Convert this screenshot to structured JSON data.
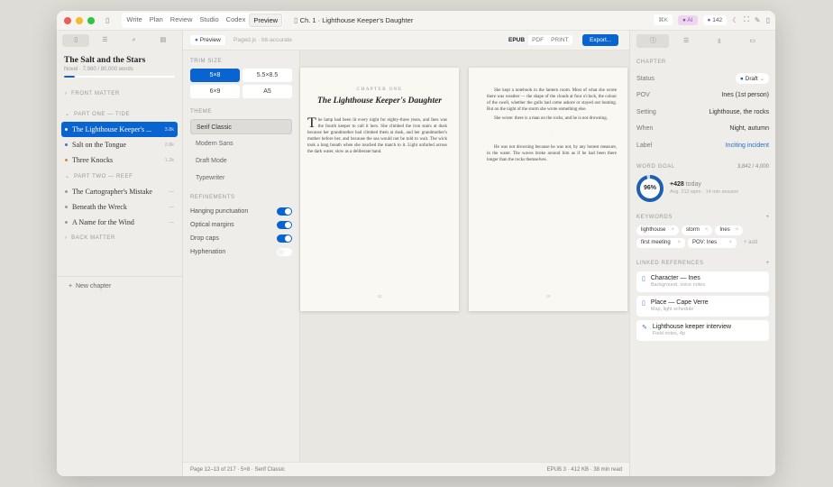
{
  "titlebar": {
    "tabs": [
      "Write",
      "Plan",
      "Review",
      "Studio",
      "Codex",
      "Preview"
    ],
    "active_tab": "Preview",
    "doc_title": "Ch. 1 · Lighthouse Keeper's Daughter",
    "cmd": "⌘K",
    "ai": "AI",
    "count": "142"
  },
  "sidebar": {
    "book_title": "The Salt and the Stars",
    "book_sub": "Novel · 7,980 / 80,000 words",
    "progress_pct": 10,
    "front_matter": "FRONT MATTER",
    "part_one": "PART ONE — TIDE",
    "part_two": "PART TWO — REEF",
    "back_matter": "BACK MATTER",
    "part_one_items": [
      {
        "label": "The Lighthouse Keeper's ...",
        "count": "3.8k",
        "dot": "#3a74d0"
      },
      {
        "label": "Salt on the Tongue",
        "count": "2.8k",
        "dot": "#3a74d0"
      },
      {
        "label": "Three Knocks",
        "count": "1.2k",
        "dot": "#c9903a"
      }
    ],
    "part_two_items": [
      {
        "label": "The Cartographer's Mistake",
        "count": "—"
      },
      {
        "label": "Beneath the Wreck",
        "count": "—"
      },
      {
        "label": "A Name for the Wind",
        "count": "—"
      }
    ],
    "new_chapter": "New chapter"
  },
  "toolbar": {
    "preview": "Preview",
    "engine": "Paged.js · bit-accurate",
    "formats": [
      "EPUB",
      "PDF",
      "PRINT"
    ],
    "active_format": "EPUB",
    "export": "Export..."
  },
  "settings": {
    "trim_label": "TRIM SIZE",
    "trims": [
      "5×8",
      "5.5×8.5",
      "6×9",
      "A5"
    ],
    "active_trim": "5×8",
    "theme_label": "THEME",
    "themes": [
      "Serif Classic",
      "Modern Sans",
      "Draft Mode",
      "Typewriter"
    ],
    "active_theme": "Serif Classic",
    "ref_label": "REFINEMENTS",
    "refinements": [
      {
        "label": "Hanging punctuation",
        "on": true
      },
      {
        "label": "Optical margins",
        "on": true
      },
      {
        "label": "Drop caps",
        "on": true
      },
      {
        "label": "Hyphenation",
        "on": false
      }
    ]
  },
  "preview": {
    "chapter_label": "CHAPTER ONE",
    "chapter_title": "The Lighthouse Keeper's Daughter",
    "drop_cap": "T",
    "p1": "he lamp had been lit every night for eighty-three years, and Ines was the fourth keeper to call it hers. She climbed the iron stairs at dusk because her grandmother had climbed them at dusk, and her grandmother's mother before her, and because the sea would not be told to wait. The wick took a long breath when she touched the match to it. Light unfurled across the dark water, slow as a deliberate hand.",
    "page_left": "12",
    "p2": "She kept a notebook in the lantern room. Most of what she wrote there was weather — the shape of the clouds at four o'clock, the colour of the swell, whether the gulls had come ashore or stayed out hunting. But on the night of the storm she wrote something else.",
    "p3": "She wrote: there is a man on the rocks, and he is not drowning.",
    "sep": "·",
    "p4": "He was not drowning because he was not, by any honest measure, in the water. The waves broke around him as if he had been there longer than the rocks themselves.",
    "page_right": "13"
  },
  "status": {
    "left": "Page 12–13 of 217 · 5×8 · Serif Classic",
    "right": "EPUB 3 · 412 KB · 38 min read"
  },
  "inspector": {
    "chapter_label": "CHAPTER",
    "fields": [
      {
        "key": "POV",
        "value": "Ines (1st person)"
      },
      {
        "key": "Setting",
        "value": "Lighthouse, the rocks"
      },
      {
        "key": "When",
        "value": "Night, autumn"
      }
    ],
    "status_key": "Status",
    "status_value": "Draft",
    "label_key": "Label",
    "label_value": "Inciting incident",
    "goal_label": "WORD GOAL",
    "goal_value": "3,842 / 4,000",
    "goal_pct": "96%",
    "today": "+428",
    "today_label": "today",
    "session": "Avg. 212 wpm · 14 min session",
    "keywords_label": "KEYWORDS",
    "keywords": [
      "lighthouse",
      "storm",
      "Ines",
      "first meeting",
      "POV: Ines"
    ],
    "add": "+ add",
    "refs_label": "LINKED REFERENCES",
    "refs": [
      {
        "title": "Character — Ines",
        "sub": "Background, voice notes"
      },
      {
        "title": "Place — Cape Verre",
        "sub": "Map, light schedule"
      },
      {
        "title": "Lighthouse keeper interview",
        "sub": "Field notes, 4p"
      }
    ]
  },
  "colors": {
    "accent": "#0a64d0",
    "ai": "#a24bb8"
  }
}
